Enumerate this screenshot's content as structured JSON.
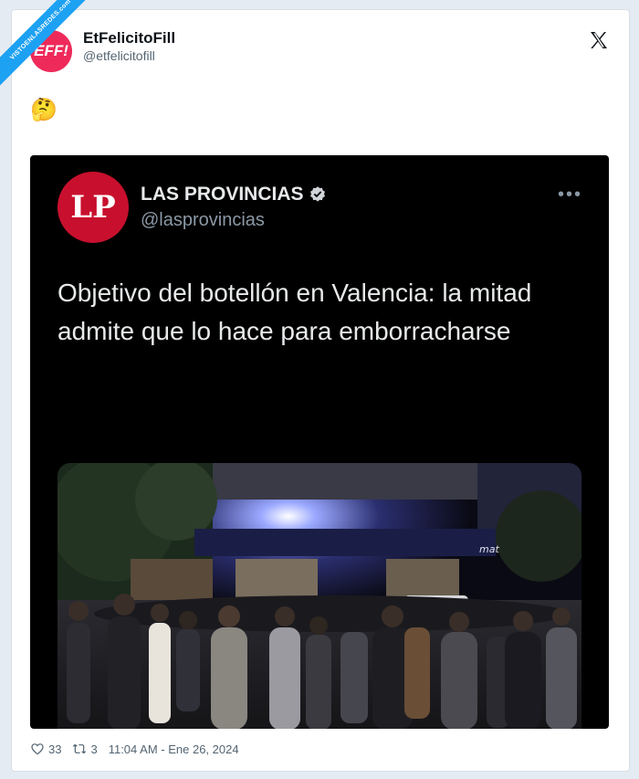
{
  "watermark": "VISTOENLASREDES.com",
  "author": {
    "avatar_text": "EFF!",
    "name": "EtFelicitoFill",
    "handle": "@etfelicitofill",
    "avatar_color": "#ee2a5a"
  },
  "tweet": {
    "text": "🤔"
  },
  "quoted": {
    "logo_text": "LP",
    "name": "LAS PROVINCIAS",
    "handle": "@lasprovincias",
    "more_icon": "more-icon",
    "headline": "Objetivo del botellón en Valencia: la mitad admite que lo hace para emborracharse",
    "logo_color": "#c8102e",
    "photo_sign_text": "mat"
  },
  "stats": {
    "likes": "33",
    "retweets": "3",
    "timestamp": "11:04 AM - Ene 26, 2024"
  },
  "icons": {
    "close": "x-logo-icon",
    "verified": "verified-badge-icon",
    "like": "heart-icon",
    "retweet": "retweet-icon"
  }
}
